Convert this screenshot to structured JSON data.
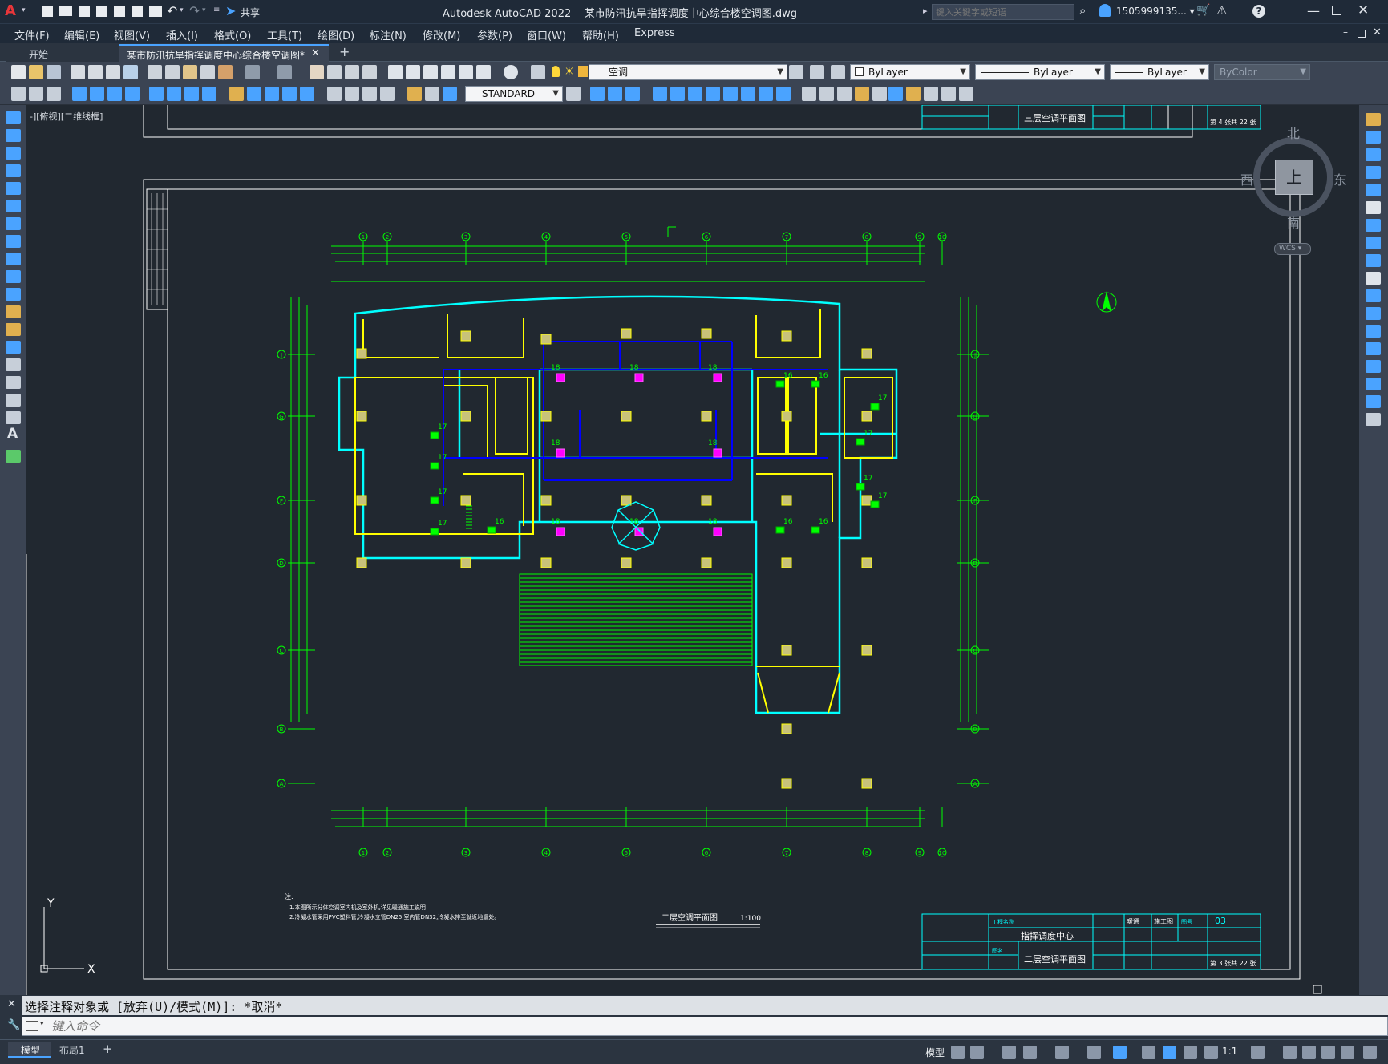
{
  "app": {
    "title": "Autodesk AutoCAD 2022",
    "filename": "某市防汛抗旱指挥调度中心综合楼空调图.dwg",
    "search_placeholder": "键入关键字或短语",
    "user": "1505999135... ▾",
    "share_label": "共享"
  },
  "menu": [
    "文件(F)",
    "编辑(E)",
    "视图(V)",
    "插入(I)",
    "格式(O)",
    "工具(T)",
    "绘图(D)",
    "标注(N)",
    "修改(M)",
    "参数(P)",
    "窗口(W)",
    "帮助(H)",
    "Express"
  ],
  "tabs": {
    "start": "开始",
    "active": "某市防汛抗旱指挥调度中心综合楼空调图*",
    "add": "+"
  },
  "toolbar": {
    "layer_value": "空调",
    "color_value": "ByLayer",
    "linetype_value": "ByLayer",
    "lineweight_value": "ByLayer",
    "plotstyle_value": "ByColor",
    "textstyle_value": "STANDARD"
  },
  "viewport": {
    "label": "-][俯视][二维线框]",
    "viewcube_top": "上",
    "north": "北",
    "south": "南",
    "east": "东",
    "west": "西",
    "wcs": "WCS",
    "ucs_y": "Y",
    "ucs_x": "X"
  },
  "drawing": {
    "title": "二层空调平面图",
    "scale": "1:100",
    "grid_top": [
      "1",
      "2",
      "3",
      "4",
      "5",
      "6",
      "7",
      "8",
      "9",
      "10"
    ],
    "grid_side": [
      "J",
      "G",
      "F",
      "D",
      "C",
      "B",
      "A"
    ],
    "unit_labels_16": "16",
    "unit_labels_17": "17",
    "unit_labels_18": "18",
    "notes_title": "注:",
    "notes_line1": "1.本图所示分体空调室内机及室外机,详见暖通施工说明",
    "notes_line2": "2.冷凝水管采用PVC塑料管,冷凝水立管DN25,室内管DN32,冷凝水排至就近地漏处。"
  },
  "titleblock": {
    "project_label": "工程名称",
    "project_value": "指挥调度中心",
    "drawing_label": "图名",
    "drawing_value": "二层空调平面图",
    "sheet_no_label": "图号",
    "sheet_no": "03",
    "specialty": "暖通",
    "stage": "施工图",
    "page_info": "第 3  张共 22 张",
    "top_drawing_value": "三层空调平面图",
    "top_page_info": "第 4  张共 22 张"
  },
  "command": {
    "history": "选择注释对象或 [放弃(U)/模式(M)]: *取消*",
    "placeholder": "键入命令"
  },
  "status": {
    "model_tab": "模型",
    "layout_tab": "布局1",
    "add": "+",
    "model_label": "模型",
    "scale": "1:1"
  },
  "colors": {
    "title_bg": "#1f2a38",
    "canvas_bg": "#212830",
    "cad_cyan": "#00ffff",
    "cad_green": "#00ff00",
    "cad_yellow": "#ffff00",
    "cad_blue": "#0000ff",
    "cad_magenta": "#ff00ff",
    "cad_white": "#ffffff"
  }
}
